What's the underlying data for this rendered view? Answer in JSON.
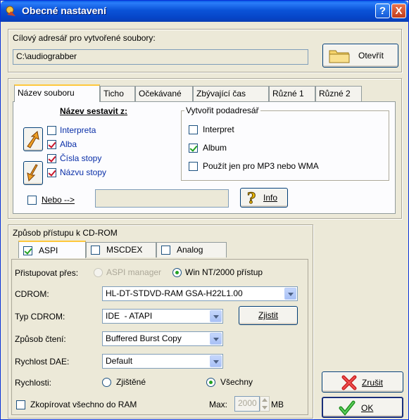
{
  "window": {
    "title": "Obecné nastavení",
    "help_label": "?",
    "close_label": "X"
  },
  "target": {
    "label": "Cílový adresář pro vytvořené soubory:",
    "path": "C:\\audiograbber",
    "open_button": "Otevřít"
  },
  "tabs": [
    {
      "label": "Název souboru",
      "active": true
    },
    {
      "label": "Ticho"
    },
    {
      "label": "Očekávané"
    },
    {
      "label": "Zbývající čas"
    },
    {
      "label": "Různé 1"
    },
    {
      "label": "Různé 2"
    }
  ],
  "filename": {
    "compose_title": "Název sestavit z:",
    "items": [
      {
        "label": "Interpreta",
        "checked": false
      },
      {
        "label": "Alba",
        "checked": true
      },
      {
        "label": "Čísla stopy",
        "checked": true
      },
      {
        "label": "Názvu stopy",
        "checked": true
      }
    ],
    "subdir_title": "Vytvořit podadresář",
    "subdir_items": [
      {
        "label": "Interpret",
        "checked": false
      },
      {
        "label": "Album",
        "checked": true
      },
      {
        "label": "Použít jen pro MP3 nebo WMA",
        "checked": false
      }
    ],
    "or_label": "Nebo -->",
    "or_value": "",
    "info_button": "Info"
  },
  "cdrom": {
    "group_title": "Způsob přístupu k CD-ROM",
    "tabs": [
      {
        "label": "ASPI",
        "checked": true
      },
      {
        "label": "MSCDEX",
        "checked": false
      },
      {
        "label": "Analog",
        "checked": false
      }
    ],
    "access_label": "Přistupovat přes:",
    "access_options": [
      "ASPI manager",
      "Win NT/2000 přístup"
    ],
    "cdrom_label": "CDROM:",
    "cdrom_value": "HL-DT-STDVD-RAM GSA-H22L1.00",
    "type_label": "Typ CDROM:",
    "type_value": "IDE  - ATAPI",
    "detect_button": "Zjistit",
    "read_label": "Způsob čtení:",
    "read_value": "Buffered Burst Copy",
    "dae_label": "Rychlost DAE:",
    "dae_value": "Default",
    "speed_label": "Rychlosti:",
    "speed_options": [
      "Zjištěné",
      "Všechny"
    ],
    "ram_label": "Zkopírovat všechno do RAM",
    "max_label": "Max:",
    "max_value": "2000",
    "max_unit": "MB"
  },
  "buttons": {
    "cancel": "Zrušit",
    "ok": "OK"
  }
}
